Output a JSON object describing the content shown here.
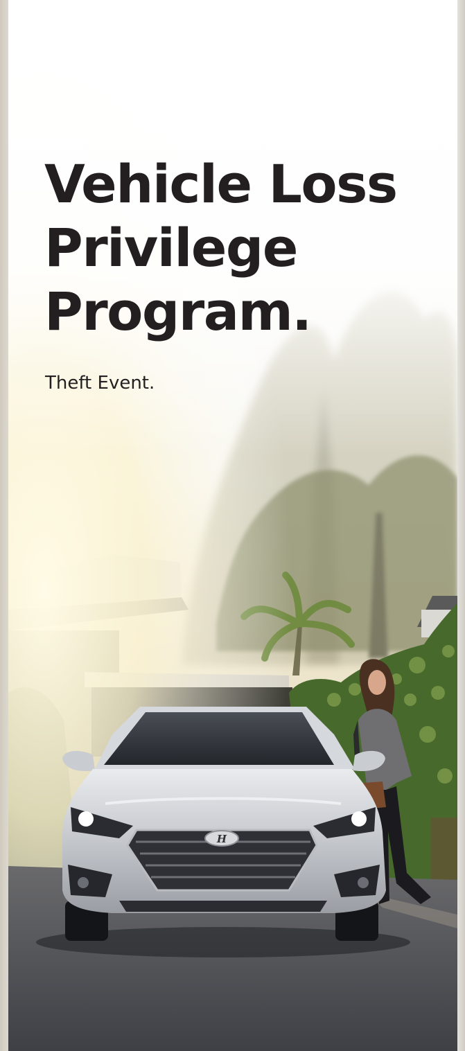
{
  "cover": {
    "title_lines": [
      "Vehicle Loss",
      "Privilege",
      "Program."
    ],
    "subtitle": "Theft Event."
  },
  "photo": {
    "subject": "silver-sedan-with-woman-in-driveway",
    "colors": {
      "sky": "#ffffff",
      "haze": "#f3efe2",
      "foliage": "#5f6e3b",
      "hedge": "#476a2c",
      "car_body": "#c9ccd0",
      "asphalt": "#4a4c52",
      "text": "#231f20"
    }
  }
}
